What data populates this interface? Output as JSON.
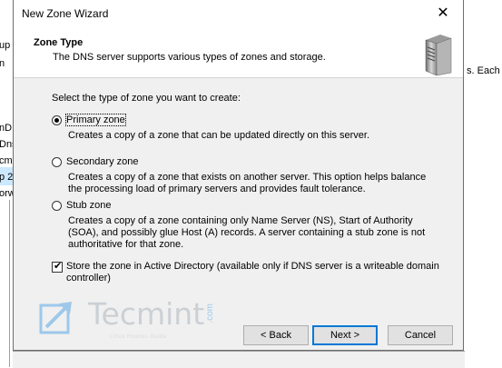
{
  "window": {
    "title": "New Zone Wizard",
    "close_glyph": "✕"
  },
  "header": {
    "title": "Zone Type",
    "subtitle": "The DNS server supports various types of zones and storage.",
    "icon": "server-tower-icon"
  },
  "prompt": "Select the type of zone you want to create:",
  "options": [
    {
      "label": "Primary zone",
      "selected": true,
      "description": [
        "Creates a copy of a zone that can be updated directly on this server."
      ]
    },
    {
      "label": "Secondary zone",
      "selected": false,
      "description": [
        "Creates a copy of a zone that exists on another server. This option helps balance",
        "the processing load of primary servers and provides fault tolerance."
      ]
    },
    {
      "label": "Stub zone",
      "selected": false,
      "description": [
        "Creates a copy of a zone containing only Name Server (NS), Start of Authority",
        "(SOA), and possibly glue Host (A) records. A server containing a stub zone is not",
        "authoritative for that zone."
      ]
    }
  ],
  "store_ad": {
    "checked": true,
    "label_line1": "Store the zone in Active Directory (available only if DNS server is a writeable domain",
    "label_line2": "controller)"
  },
  "buttons": {
    "back": "< Back",
    "next": "Next >",
    "cancel": "Cancel"
  },
  "watermark": {
    "brand": "Tecmint",
    "suffix": ".com",
    "tagline": "Linux Howtos Guide"
  },
  "background": {
    "left_fragments": [
      "up",
      "n",
      "nD",
      "Dns",
      "p 2",
      "cm",
      "p 2",
      "orw"
    ],
    "right_fragment": "s. Each z"
  },
  "colors": {
    "accent": "#0078d7",
    "dialog_bg": "#f0f0f0"
  }
}
